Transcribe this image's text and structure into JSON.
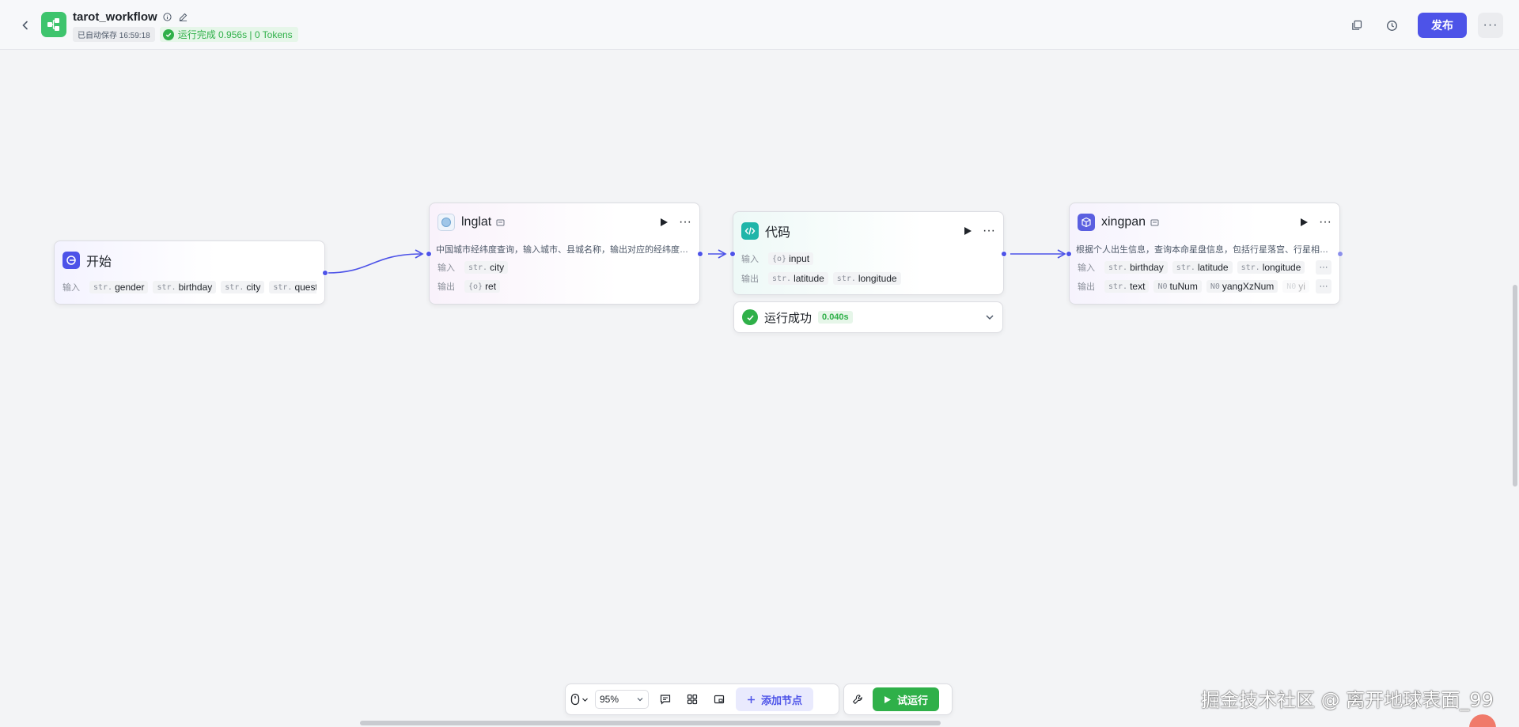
{
  "header": {
    "back_icon": "chevron-left-icon",
    "logo_icon": "workflow-icon",
    "logo_color": "#3ec46d",
    "title": "tarot_workflow",
    "autosave": "已自动保存 16:59:18",
    "run_status": "运行完成 0.956s | 0 Tokens",
    "publish_label": "发布",
    "publish_color": "#4d53e8"
  },
  "nodes": {
    "start": {
      "title": "开始",
      "input_label": "输入",
      "inputs": [
        {
          "type": "str.",
          "name": "gender"
        },
        {
          "type": "str.",
          "name": "birthday"
        },
        {
          "type": "str.",
          "name": "city"
        },
        {
          "type": "str.",
          "name": "question"
        }
      ]
    },
    "lnglat": {
      "title": "lnglat",
      "description": "中国城市经纬度查询，输入城市、县城名称，输出对应的经纬度信息",
      "input_label": "输入",
      "output_label": "输出",
      "inputs": [
        {
          "type": "str.",
          "name": "city"
        }
      ],
      "outputs": [
        {
          "type": "{o}",
          "name": "ret"
        }
      ]
    },
    "code": {
      "title": "代码",
      "input_label": "输入",
      "output_label": "输出",
      "inputs": [
        {
          "type": "{o}",
          "name": "input"
        }
      ],
      "outputs": [
        {
          "type": "str.",
          "name": "latitude"
        },
        {
          "type": "str.",
          "name": "longitude"
        }
      ]
    },
    "xingpan": {
      "title": "xingpan",
      "description": "根据个人出生信息，查询本命星盘信息，包括行星落宫、行星相位等",
      "input_label": "输入",
      "output_label": "输出",
      "inputs": [
        {
          "type": "str.",
          "name": "birthday"
        },
        {
          "type": "str.",
          "name": "latitude"
        },
        {
          "type": "str.",
          "name": "longitude"
        }
      ],
      "outputs": [
        {
          "type": "str.",
          "name": "text"
        },
        {
          "type": "N0",
          "name": "tuNum"
        },
        {
          "type": "N0",
          "name": "yangXzNum"
        },
        {
          "type": "N0",
          "name": "yi"
        }
      ]
    }
  },
  "run_result": {
    "text": "运行成功",
    "time": "0.040s"
  },
  "toolbar": {
    "zoom": "95%",
    "add_node_label": "添加节点",
    "test_run_label": "试运行",
    "test_run_color": "#2fb049"
  },
  "watermark": "掘金技术社区 @ 离开地球表面_99"
}
